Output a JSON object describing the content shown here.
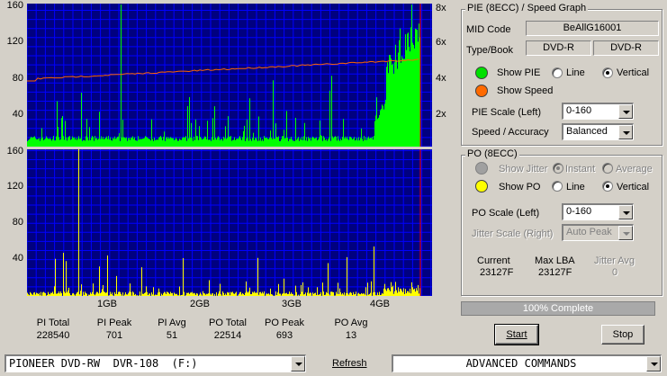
{
  "pie_graph": {
    "y_labels": [
      "160",
      "120",
      "80",
      "40"
    ],
    "speed_labels": [
      "8x",
      "6x",
      "4x",
      "2x"
    ]
  },
  "po_graph": {
    "y_labels": [
      "160",
      "120",
      "80",
      "40"
    ]
  },
  "x_labels": [
    "1GB",
    "2GB",
    "3GB",
    "4GB"
  ],
  "stats": {
    "pi_total_label": "PI Total",
    "pi_total": "228540",
    "pi_peak_label": "PI Peak",
    "pi_peak": "701",
    "pi_avg_label": "PI Avg",
    "pi_avg": "51",
    "po_total_label": "PO Total",
    "po_total": "22514",
    "po_peak_label": "PO Peak",
    "po_peak": "693",
    "po_avg_label": "PO Avg",
    "po_avg": "13"
  },
  "pie_panel": {
    "title": "PIE (8ECC) / Speed Graph",
    "mid_code_label": "MID Code",
    "mid_code": "BeAllG16001",
    "type_book_label": "Type/Book",
    "type": "DVD-R",
    "book": "DVD-R",
    "show_pie_label": "Show PIE",
    "line_label": "Line",
    "vertical_label": "Vertical",
    "show_speed_label": "Show Speed",
    "pie_scale_label": "PIE Scale (Left)",
    "pie_scale_value": "0-160",
    "speed_accuracy_label": "Speed / Accuracy",
    "speed_accuracy_value": "Balanced"
  },
  "po_panel": {
    "title": "PO (8ECC)",
    "show_jitter_label": "Show Jitter",
    "instant_label": "Instant",
    "average_label": "Average",
    "show_po_label": "Show PO",
    "line_label": "Line",
    "vertical_label": "Vertical",
    "po_scale_label": "PO Scale (Left)",
    "po_scale_value": "0-160",
    "jitter_scale_label": "Jitter Scale (Right)",
    "jitter_scale_value": "Auto Peak",
    "current_label": "Current",
    "current_value": "23127F",
    "max_lba_label": "Max LBA",
    "max_lba_value": "23127F",
    "jitter_avg_label": "Jitter Avg",
    "jitter_avg_value": "0"
  },
  "progress": {
    "text": "100% Complete",
    "percent": 100
  },
  "buttons": {
    "start": "Start",
    "stop": "Stop",
    "refresh": "Refresh"
  },
  "drive_select": "PIONEER DVD-RW  DVR-108  (F:)",
  "command_select": "ADVANCED COMMANDS",
  "colors": {
    "graph_bg": "#000080",
    "grid": "#0000ff",
    "pie_bars": "#00ff00",
    "po_bars": "#ffff00",
    "speed_line": "#ff6600",
    "end_marker": "#ff0000",
    "led_green": "#00e000",
    "led_orange": "#ff6a00",
    "led_gray": "#a0a0a0",
    "led_yellow": "#ffff00"
  }
}
